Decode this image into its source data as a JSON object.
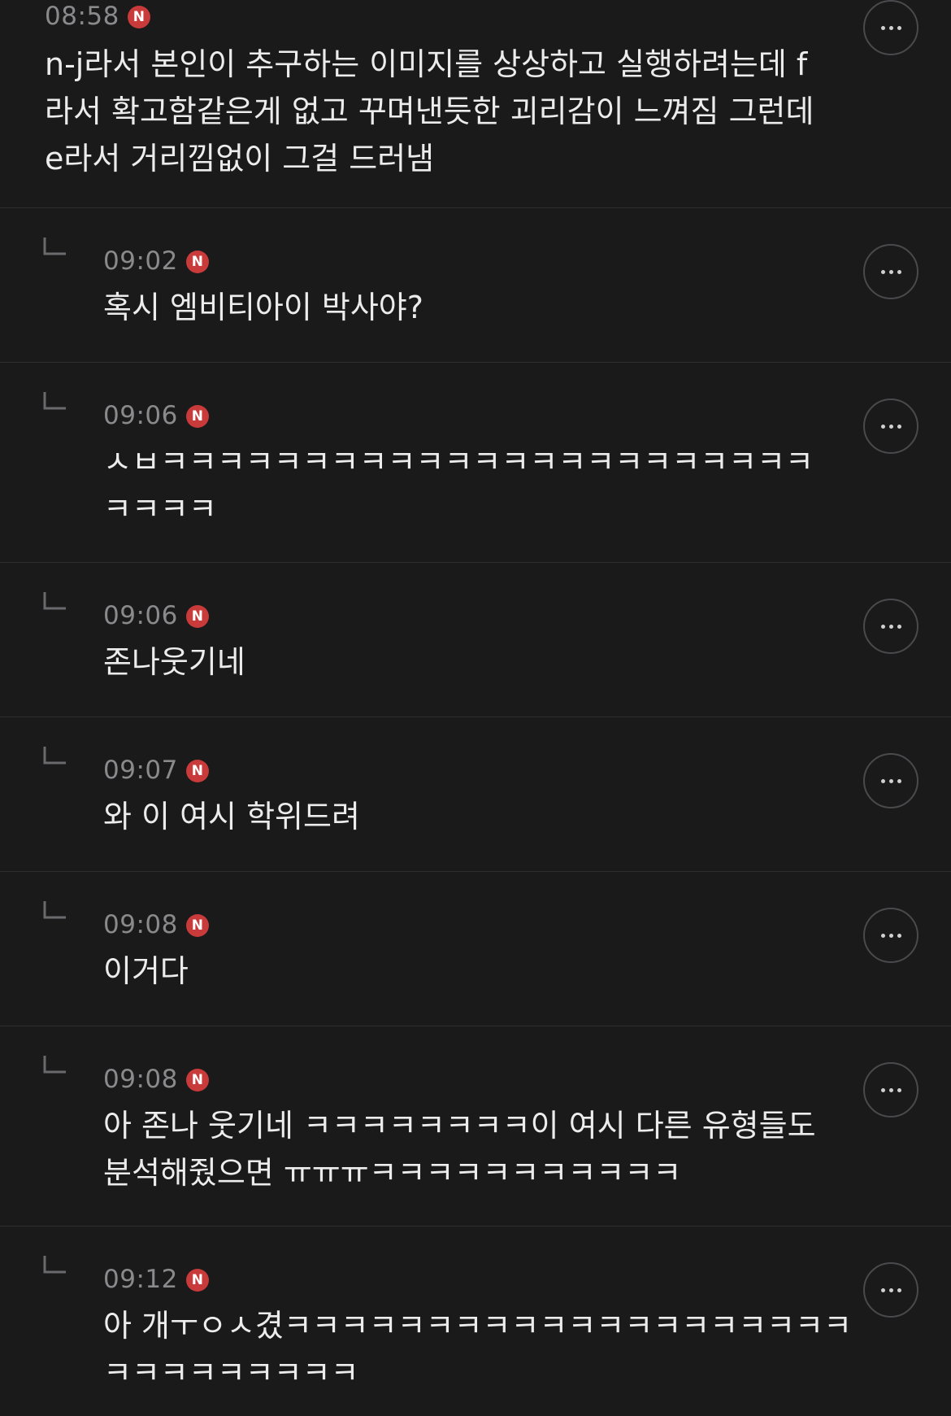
{
  "comments": [
    {
      "time": "08:58",
      "badge": "N",
      "lines": [
        "n-j라서 본인이 추구하는 이미지를 상상하고 실행하려는데 f",
        "라서 확고함같은게 없고 꾸며낸듯한 괴리감이 느껴짐 그런데",
        "e라서 거리낌없이 그걸 드러냄"
      ]
    },
    {
      "time": "09:02",
      "badge": "N",
      "lines": [
        "혹시 엠비티아이 박사야?"
      ]
    },
    {
      "time": "09:06",
      "badge": "N",
      "lines": [
        "ㅅㅂㅋㅋㅋㅋㅋㅋㅋㅋㅋㅋㅋㅋㅋㅋㅋㅋㅋㅋㅋㅋㅋㅋㅋ",
        "ㅋㅋㅋㅋ"
      ]
    },
    {
      "time": "09:06",
      "badge": "N",
      "lines": [
        "존나웃기네"
      ]
    },
    {
      "time": "09:07",
      "badge": "N",
      "lines": [
        "와 이 여시 학위드려"
      ]
    },
    {
      "time": "09:08",
      "badge": "N",
      "lines": [
        "이거다"
      ]
    },
    {
      "time": "09:08",
      "badge": "N",
      "lines": [
        "아 존나 웃기네 ㅋㅋㅋㅋㅋㅋㅋㅋ이 여시 다른 유형들도",
        "분석해줬으면 ㅠㅠㅠㅋㅋㅋㅋㅋㅋㅋㅋㅋㅋㅋ"
      ]
    },
    {
      "time": "09:12",
      "badge": "N",
      "lines": [
        "아 개ㅜㅇㅅ겼ㅋㅋㅋㅋㅋㅋㅋㅋㅋㅋㅋㅋㅋㅋㅋㅋㅋㅋㅋㅋ",
        "ㅋㅋㅋㅋㅋㅋㅋㅋㅋ"
      ]
    }
  ],
  "icons": {
    "reply": "reply-arrow-icon",
    "more": "more-options-icon"
  }
}
